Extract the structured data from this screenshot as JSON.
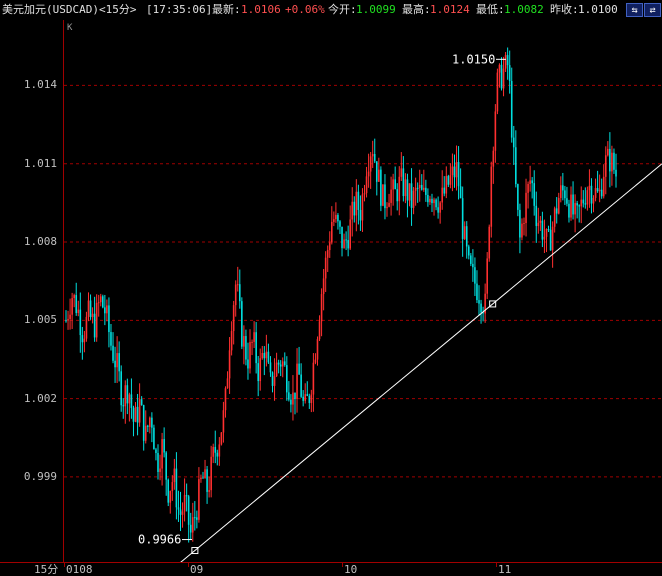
{
  "header": {
    "title": "美元加元(USDCAD)<15分>",
    "time": "[17:35:06]",
    "latest_label": "最新:",
    "latest_value": "1.0106",
    "change": "+0.06%",
    "open_label": "今开:",
    "open_value": "1.0099",
    "high_label": "最高:",
    "high_value": "1.0124",
    "low_label": "最低:",
    "low_value": "1.0082",
    "prev_label": "昨收:",
    "prev_value": "1.0100"
  },
  "period_label": "15分",
  "corner_mark": "K",
  "colors": {
    "up": "#ff3030",
    "down": "#00e0e0",
    "grid": "#a00000",
    "trend": "#ffffff"
  },
  "chart_data": {
    "type": "candlestick",
    "y_ticks": [
      "1.014",
      "1.011",
      "1.008",
      "1.005",
      "1.002",
      "0.999"
    ],
    "ylim": [
      0.9962,
      1.0162
    ],
    "x_labels": [
      "0108",
      "09",
      "10",
      "11"
    ],
    "max_annotation": "1.0150",
    "min_annotation": "0.9966",
    "grid": true,
    "path": [
      1.005,
      1.006,
      1.0055,
      1.0045,
      1.0052,
      1.0048,
      1.0058,
      1.0053,
      1.004,
      1.0032,
      1.002,
      1.0025,
      1.001,
      1.0018,
      1.0005,
      1.0015,
      0.9995,
      1.0002,
      0.9985,
      0.999,
      0.9975,
      0.998,
      0.9968,
      0.9978,
      0.999,
      0.9985,
      0.9998,
      1.0005,
      1.0015,
      1.0048,
      1.0065,
      1.0045,
      1.0035,
      1.0042,
      1.003,
      1.004,
      1.0025,
      1.0032,
      1.0035,
      1.0028,
      1.002,
      1.003,
      1.0015,
      1.0022,
      1.004,
      1.006,
      1.0075,
      1.009,
      1.0085,
      1.0078,
      1.0085,
      1.0095,
      1.0092,
      1.011,
      1.0118,
      1.0105,
      1.0095,
      1.01,
      1.0098,
      1.0103,
      1.01,
      1.0095,
      1.01,
      1.0097,
      1.01,
      1.0098,
      1.0095,
      1.01,
      1.0105,
      1.0108,
      1.0085,
      1.007,
      1.0065,
      1.006,
      1.0055,
      1.011,
      1.014,
      1.0145,
      1.0148,
      1.011,
      1.008,
      1.0095,
      1.0105,
      1.009,
      1.0085,
      1.0078,
      1.0088,
      1.0098,
      1.01,
      1.0093,
      1.0088,
      1.0095,
      1.0102,
      1.01,
      1.0097,
      1.011,
      1.0112,
      1.0106
    ],
    "trendline": {
      "from": [
        0.9952,
        0.0
      ],
      "to": [
        1.011,
        1.0
      ]
    }
  }
}
